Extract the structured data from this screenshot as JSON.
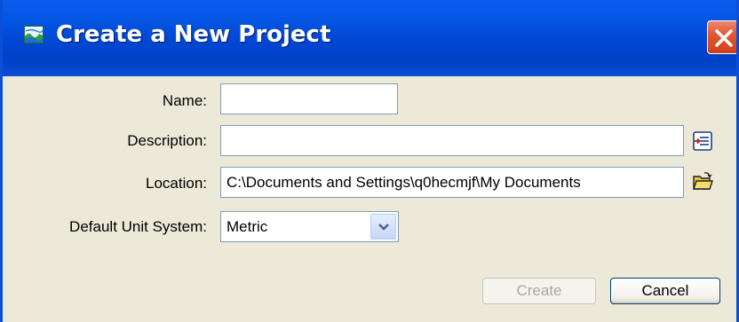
{
  "window": {
    "title": "Create a New Project"
  },
  "form": {
    "name": {
      "label": "Name:",
      "value": ""
    },
    "description": {
      "label": "Description:",
      "value": ""
    },
    "location": {
      "label": "Location:",
      "value": "C:\\Documents and Settings\\q0hecmjf\\My Documents"
    },
    "unit_system": {
      "label": "Default Unit System:",
      "value": "Metric"
    }
  },
  "buttons": {
    "create": "Create",
    "cancel": "Cancel"
  },
  "icons": {
    "app": "landscape-app-icon",
    "close": "close-icon",
    "description_edit": "edit-text-icon",
    "location_browse": "open-folder-icon",
    "dropdown": "chevron-down-icon"
  },
  "colors": {
    "titlebar": "#0047d3",
    "close_button": "#e25a32",
    "dialog_bg": "#ece9d8",
    "disabled_text": "#aca899"
  }
}
